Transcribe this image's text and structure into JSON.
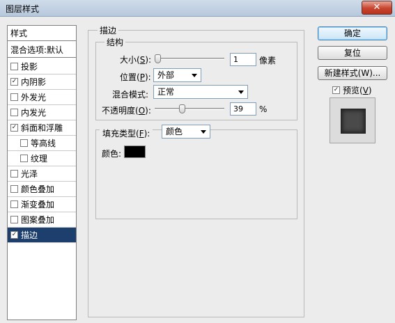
{
  "window": {
    "title": "图层样式",
    "close_glyph": "✕"
  },
  "styles_panel": {
    "header": "样式",
    "blend_options": "混合选项:默认",
    "items": [
      {
        "label": "投影",
        "checked": false
      },
      {
        "label": "内阴影",
        "checked": true
      },
      {
        "label": "外发光",
        "checked": false
      },
      {
        "label": "内发光",
        "checked": false
      },
      {
        "label": "斜面和浮雕",
        "checked": true
      },
      {
        "label": "等高线",
        "checked": false,
        "sub": true
      },
      {
        "label": "纹理",
        "checked": false,
        "sub": true
      },
      {
        "label": "光泽",
        "checked": false
      },
      {
        "label": "颜色叠加",
        "checked": false
      },
      {
        "label": "渐变叠加",
        "checked": false
      },
      {
        "label": "图案叠加",
        "checked": false
      },
      {
        "label": "描边",
        "checked": true,
        "selected": true
      }
    ]
  },
  "stroke": {
    "group_title": "描边",
    "structure": {
      "title": "结构",
      "size_label": "大小(",
      "size_key": "S",
      "size_value": "1",
      "size_unit": "像素",
      "size_slider_value": 1,
      "position_label": "位置(",
      "position_key": "P",
      "position_value": "外部",
      "blend_mode_label": "混合模式:",
      "blend_mode_value": "正常",
      "opacity_label": "不透明度(",
      "opacity_key": "O",
      "opacity_value": "39",
      "opacity_unit": "%",
      "opacity_slider_value": 39
    },
    "fill": {
      "type_label": "填充类型(",
      "type_key": "F",
      "type_value": "颜色",
      "color_label": "颜色:",
      "color_value": "#000000"
    }
  },
  "buttons": {
    "ok": "确定",
    "reset": "复位",
    "new_style": "新建样式(W)..."
  },
  "preview": {
    "label": "预览(",
    "key": "V",
    "checked": true
  }
}
